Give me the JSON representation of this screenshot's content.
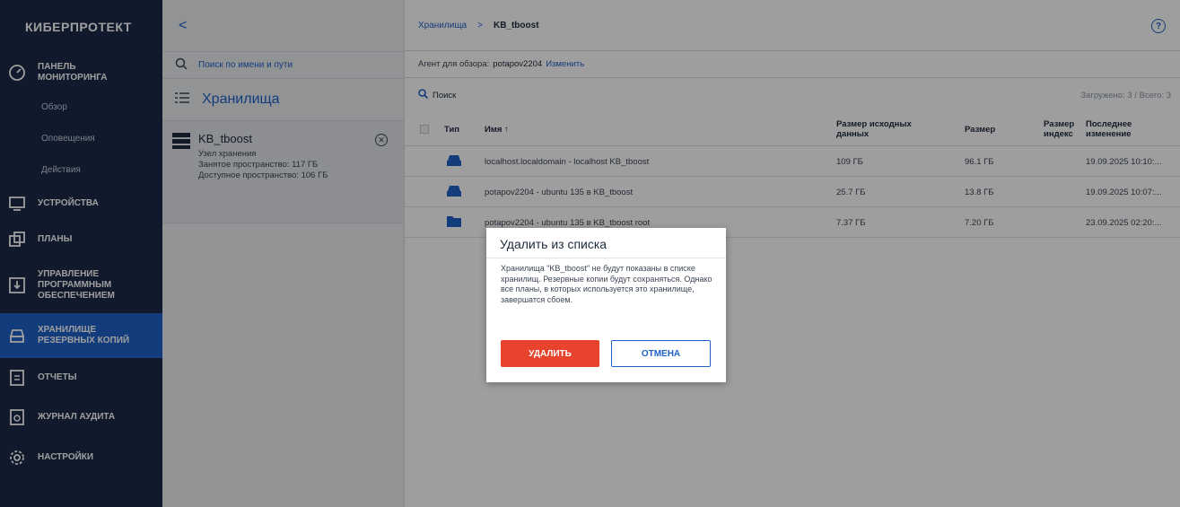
{
  "brand": "КИБЕРПРОТЕКТ",
  "sidebar": {
    "monitoring": "ПАНЕЛЬ МОНИТОРИНГА",
    "sub_items": [
      "Обзор",
      "Оповещения",
      "Действия"
    ],
    "devices": "УСТРОЙСТВА",
    "plans": "ПЛАНЫ",
    "software": "УПРАВЛЕНИЕ ПРОГРАММНЫМ ОБЕСПЕЧЕНИЕМ",
    "storage": "ХРАНИЛИЩЕ РЕЗЕРВНЫХ КОПИЙ",
    "reports": "ОТЧЕТЫ",
    "audit": "ЖУРНАЛ АУДИТА",
    "settings": "НАСТРОЙКИ"
  },
  "middle": {
    "back": "<",
    "search_placeholder": "Поиск по имени и пути",
    "title": "Хранилища",
    "storage": {
      "name": "KB_tboost",
      "type": "Узел хранения",
      "used": "Занятое пространство: 117 ГБ",
      "free": "Доступное пространство: 106 ГБ"
    }
  },
  "main": {
    "breadcrumb_root": "Хранилища",
    "breadcrumb_sep": ">",
    "breadcrumb_current": "KB_tboost",
    "agent_label": "Агент для обзора:",
    "agent_value": "potapov2204",
    "agent_change": "Изменить",
    "search": "Поиск",
    "loaded": "Загружено: 3 / Всего: 3",
    "columns": {
      "type": "Тип",
      "name": "Имя ↑",
      "src_size": "Размер исходных данных",
      "size": "Размер",
      "index": "Размер индекс",
      "modified": "Последнее изменение"
    },
    "rows": [
      {
        "name": "localhost.localdomain - localhost KB_tboost",
        "src": "109 ГБ",
        "size": "96.1 ГБ",
        "date": "19.09.2025 10:10:..."
      },
      {
        "name": "potapov2204 - ubuntu 135 в KB_tboost",
        "src": "25.7 ГБ",
        "size": "13.8 ГБ",
        "date": "19.09.2025 10:07:..."
      },
      {
        "name": "potapov2204 - ubuntu 135 в KB_tboost root",
        "src": "7.37 ГБ",
        "size": "7.20 ГБ",
        "date": "23.09.2025 02:20:..."
      }
    ]
  },
  "dialog": {
    "title": "Удалить из списка",
    "text": "Хранилища \"KB_tboost\" не будут показаны в списке хранилищ. Резервные копии будут сохраняться. Однако все планы, в которых используется это хранилище, завершатся сбоем.",
    "delete": "УДАЛИТЬ",
    "cancel": "ОТМЕНА"
  },
  "colors": {
    "sidebar": "#1a2a47",
    "active": "#1e62c8",
    "accent": "#1e62c8",
    "danger": "#e8432d"
  }
}
